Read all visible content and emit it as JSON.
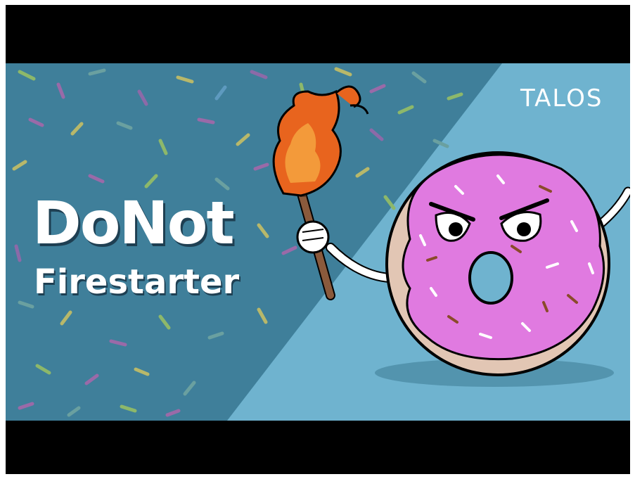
{
  "thumbnail": {
    "title_line1": "DoNot",
    "title_line2": "Firestarter",
    "brand_logo": "TALOS"
  },
  "colors": {
    "background_dark": "#3f7f9a",
    "background_light": "#6fb3cf",
    "title_text": "#ffffff",
    "title_shadow": "#1e3f52",
    "donut_icing": "#e07ae0",
    "donut_dough": "#e2c6b4",
    "flame": "#e8641e",
    "letterbox": "#000000"
  },
  "icons": [
    "donut-character-icon",
    "torch-icon",
    "flame-icon",
    "sprinkles-pattern"
  ]
}
